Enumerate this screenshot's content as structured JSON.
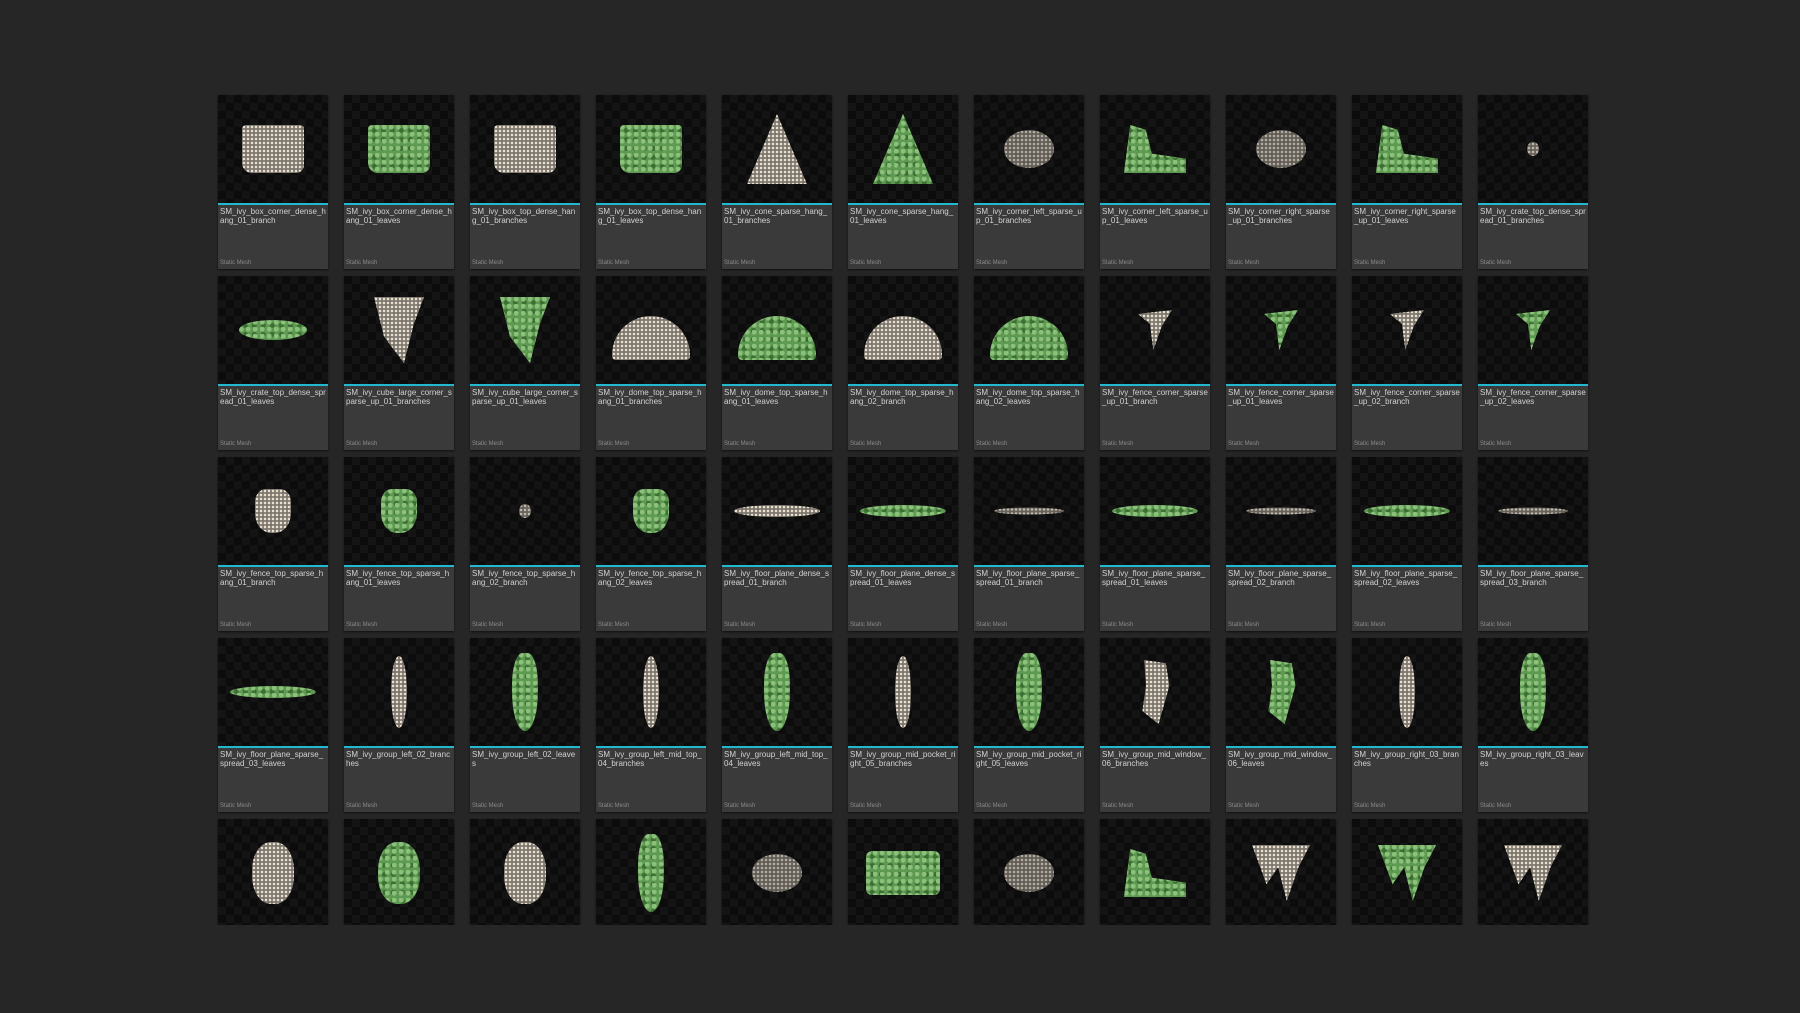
{
  "assets": [
    {
      "name": "SM_ivy_box_corner_dense_hang_01_branch",
      "type": "Static Mesh",
      "thumb": "branch",
      "shape": "box"
    },
    {
      "name": "SM_ivy_box_corner_dense_hang_01_leaves",
      "type": "Static Mesh",
      "thumb": "leaves",
      "shape": "box"
    },
    {
      "name": "SM_ivy_box_top_dense_hang_01_branches",
      "type": "Static Mesh",
      "thumb": "branch",
      "shape": "box"
    },
    {
      "name": "SM_ivy_box_top_dense_hang_01_leaves",
      "type": "Static Mesh",
      "thumb": "leaves",
      "shape": "box"
    },
    {
      "name": "SM_ivy_cone_sparse_hang_01_branches",
      "type": "Static Mesh",
      "thumb": "branch",
      "shape": "cone"
    },
    {
      "name": "SM_ivy_cone_sparse_hang_01_leaves",
      "type": "Static Mesh",
      "thumb": "leaves",
      "shape": "cone"
    },
    {
      "name": "SM_ivy_corner_left_sparse_up_01_branches",
      "type": "Static Mesh",
      "thumb": "branch",
      "shape": "sparse"
    },
    {
      "name": "SM_ivy_corner_left_sparse_up_01_leaves",
      "type": "Static Mesh",
      "thumb": "leaves",
      "shape": "corner"
    },
    {
      "name": "SM_ivy_corner_right_sparse_up_01_branches",
      "type": "Static Mesh",
      "thumb": "branch",
      "shape": "sparse"
    },
    {
      "name": "SM_ivy_corner_right_sparse_up_01_leaves",
      "type": "Static Mesh",
      "thumb": "leaves",
      "shape": "corner"
    },
    {
      "name": "SM_ivy_crate_top_dense_spread_01_branches",
      "type": "Static Mesh",
      "thumb": "branch",
      "shape": "hang-sm"
    },
    {
      "name": "SM_ivy_crate_top_dense_spread_01_leaves",
      "type": "Static Mesh",
      "thumb": "leaves",
      "shape": "spread"
    },
    {
      "name": "SM_ivy_cube_large_corner_sparse_up_01_branches",
      "type": "Static Mesh",
      "thumb": "branch",
      "shape": "cube"
    },
    {
      "name": "SM_ivy_cube_large_corner_sparse_up_01_leaves",
      "type": "Static Mesh",
      "thumb": "leaves",
      "shape": "cube"
    },
    {
      "name": "SM_ivy_dome_top_sparse_hang_01_branches",
      "type": "Static Mesh",
      "thumb": "branch",
      "shape": "dome"
    },
    {
      "name": "SM_ivy_dome_top_sparse_hang_01_leaves",
      "type": "Static Mesh",
      "thumb": "leaves",
      "shape": "dome"
    },
    {
      "name": "SM_ivy_dome_top_sparse_hang_02_branch",
      "type": "Static Mesh",
      "thumb": "branch",
      "shape": "dome"
    },
    {
      "name": "SM_ivy_dome_top_sparse_hang_02_leaves",
      "type": "Static Mesh",
      "thumb": "leaves",
      "shape": "dome"
    },
    {
      "name": "SM_ivy_fence_corner_sparse_up_01_branch",
      "type": "Static Mesh",
      "thumb": "branch",
      "shape": "fence"
    },
    {
      "name": "SM_ivy_fence_corner_sparse_up_01_leaves",
      "type": "Static Mesh",
      "thumb": "leaves",
      "shape": "fence"
    },
    {
      "name": "SM_ivy_fence_corner_sparse_up_02_branch",
      "type": "Static Mesh",
      "thumb": "branch",
      "shape": "fence"
    },
    {
      "name": "SM_ivy_fence_corner_sparse_up_02_leaves",
      "type": "Static Mesh",
      "thumb": "leaves",
      "shape": "fence"
    },
    {
      "name": "SM_ivy_fence_top_sparse_hang_01_branch",
      "type": "Static Mesh",
      "thumb": "branch",
      "shape": "hang"
    },
    {
      "name": "SM_ivy_fence_top_sparse_hang_01_leaves",
      "type": "Static Mesh",
      "thumb": "leaves",
      "shape": "hang"
    },
    {
      "name": "SM_ivy_fence_top_sparse_hang_02_branch",
      "type": "Static Mesh",
      "thumb": "branch",
      "shape": "hang-sm"
    },
    {
      "name": "SM_ivy_fence_top_sparse_hang_02_leaves",
      "type": "Static Mesh",
      "thumb": "leaves",
      "shape": "hang"
    },
    {
      "name": "SM_ivy_floor_plane_dense_spread_01_branch",
      "type": "Static Mesh",
      "thumb": "branch",
      "shape": "plane"
    },
    {
      "name": "SM_ivy_floor_plane_dense_spread_01_leaves",
      "type": "Static Mesh",
      "thumb": "leaves",
      "shape": "plane"
    },
    {
      "name": "SM_ivy_floor_plane_sparse_spread_01_branch",
      "type": "Static Mesh",
      "thumb": "branch",
      "shape": "plane-s"
    },
    {
      "name": "SM_ivy_floor_plane_sparse_spread_01_leaves",
      "type": "Static Mesh",
      "thumb": "leaves",
      "shape": "plane"
    },
    {
      "name": "SM_ivy_floor_plane_sparse_spread_02_branch",
      "type": "Static Mesh",
      "thumb": "branch",
      "shape": "plane-s"
    },
    {
      "name": "SM_ivy_floor_plane_sparse_spread_02_leaves",
      "type": "Static Mesh",
      "thumb": "leaves",
      "shape": "plane"
    },
    {
      "name": "SM_ivy_floor_plane_sparse_spread_03_branch",
      "type": "Static Mesh",
      "thumb": "branch",
      "shape": "plane-s"
    },
    {
      "name": "SM_ivy_floor_plane_sparse_spread_03_leaves",
      "type": "Static Mesh",
      "thumb": "leaves",
      "shape": "plane"
    },
    {
      "name": "SM_ivy_group_left_02_branches",
      "type": "Static Mesh",
      "thumb": "branch",
      "shape": "group"
    },
    {
      "name": "SM_ivy_group_left_02_leaves",
      "type": "Static Mesh",
      "thumb": "leaves",
      "shape": "group-w"
    },
    {
      "name": "SM_ivy_group_left_mid_top_04_branches",
      "type": "Static Mesh",
      "thumb": "branch",
      "shape": "group"
    },
    {
      "name": "SM_ivy_group_left_mid_top_04_leaves",
      "type": "Static Mesh",
      "thumb": "leaves",
      "shape": "group-w"
    },
    {
      "name": "SM_ivy_group_mid_pocket_right_05_branches",
      "type": "Static Mesh",
      "thumb": "branch",
      "shape": "group"
    },
    {
      "name": "SM_ivy_group_mid_pocket_right_05_leaves",
      "type": "Static Mesh",
      "thumb": "leaves",
      "shape": "group-w"
    },
    {
      "name": "SM_ivy_group_mid_window_06_branches",
      "type": "Static Mesh",
      "thumb": "branch",
      "shape": "window"
    },
    {
      "name": "SM_ivy_group_mid_window_06_leaves",
      "type": "Static Mesh",
      "thumb": "leaves",
      "shape": "window"
    },
    {
      "name": "SM_ivy_group_right_03_branches",
      "type": "Static Mesh",
      "thumb": "branch",
      "shape": "group"
    },
    {
      "name": "SM_ivy_group_right_03_leaves",
      "type": "Static Mesh",
      "thumb": "leaves",
      "shape": "group-w"
    },
    {
      "name": "",
      "type": "",
      "thumb": "branch",
      "shape": "clump"
    },
    {
      "name": "",
      "type": "",
      "thumb": "leaves",
      "shape": "clump"
    },
    {
      "name": "",
      "type": "",
      "thumb": "branch",
      "shape": "clump"
    },
    {
      "name": "",
      "type": "",
      "thumb": "leaves",
      "shape": "group-w"
    },
    {
      "name": "",
      "type": "",
      "thumb": "branch",
      "shape": "sparse"
    },
    {
      "name": "",
      "type": "",
      "thumb": "leaves",
      "shape": "wall"
    },
    {
      "name": "",
      "type": "",
      "thumb": "branch",
      "shape": "sparse"
    },
    {
      "name": "",
      "type": "",
      "thumb": "leaves",
      "shape": "corner"
    },
    {
      "name": "",
      "type": "",
      "thumb": "branch",
      "shape": "drip"
    },
    {
      "name": "",
      "type": "",
      "thumb": "leaves",
      "shape": "drip"
    },
    {
      "name": "",
      "type": "",
      "thumb": "branch",
      "shape": "drip"
    }
  ],
  "colors": {
    "background": "#262626",
    "tile": "#3a3a3a",
    "accent": "#22b8cf",
    "leaves": "#5f9a52",
    "branch": "#d7cdbe"
  }
}
